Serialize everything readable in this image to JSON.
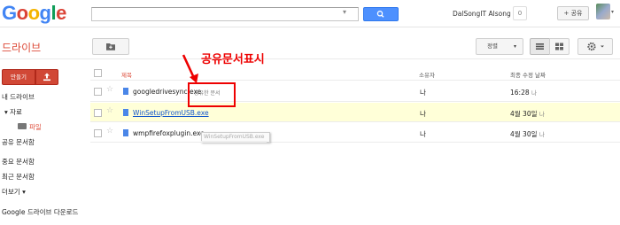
{
  "header": {
    "logo": {
      "l1": "G",
      "l2": "o",
      "l3": "o",
      "l4": "g",
      "l5": "l",
      "l6": "e"
    },
    "search": {
      "placeholder": "",
      "value": ""
    },
    "user_name": "DalSongIT Alsong",
    "notifications": "0",
    "share_label": "+ 공유"
  },
  "toolbar": {
    "app_title": "드라이브",
    "sort_label": "정렬"
  },
  "sidebar": {
    "create_label": "만들기",
    "items": [
      {
        "label": "내 드라이브"
      },
      {
        "label": "▾ 자료"
      },
      {
        "label": "파일"
      },
      {
        "label": "공유 문서함"
      },
      {
        "label": "중요 문서함"
      },
      {
        "label": "최근 문서함"
      },
      {
        "label": "더보기 ▾"
      },
      {
        "label": "Google 드라이브 다운로드"
      }
    ]
  },
  "list": {
    "columns": {
      "title": "제목",
      "owner": "소유자",
      "modified": "최종 수정 날짜"
    },
    "rows": [
      {
        "name": "googledrivesync.exe",
        "owner": "나",
        "date": "16:28",
        "who": "나"
      },
      {
        "name": "WinSetupFromUSB.exe",
        "owner": "나",
        "date": "4월 30일",
        "who": "나"
      },
      {
        "name": "wmpfirefoxplugin.exe",
        "owner": "나",
        "date": "4월 30일",
        "who": "나"
      }
    ],
    "shared_badge": "공유한 문서",
    "tooltip": "WinSetupFromUSB.exe"
  },
  "annotation": {
    "text": "공유문서표시"
  },
  "colors": {
    "accent": "#dd4b39",
    "search_blue": "#4d90fe",
    "highlight_row": "#ffffd8",
    "annotation_red": "#ee0000"
  }
}
